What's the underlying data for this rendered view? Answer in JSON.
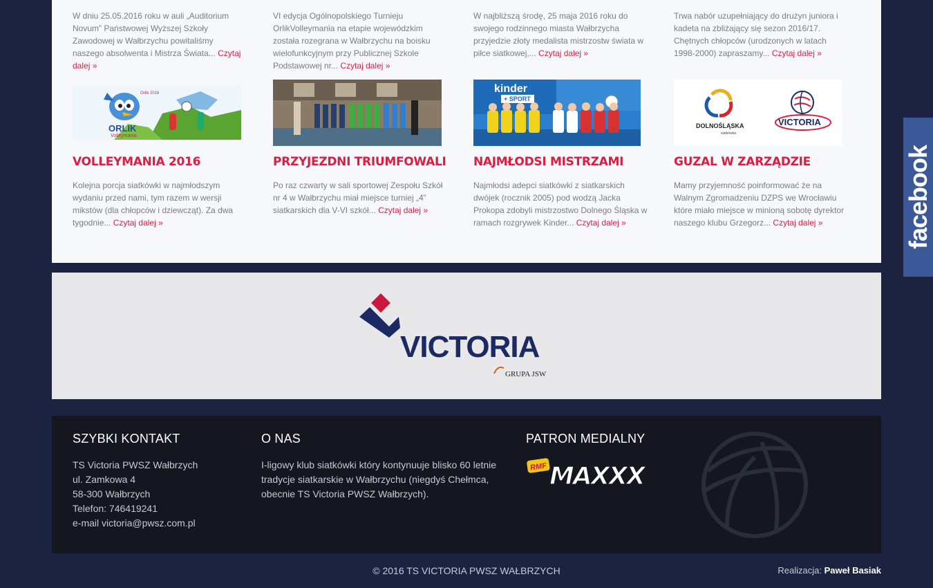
{
  "articles_top": [
    {
      "excerpt": "W dniu 25.05.2016 roku w auli „Auditorium Novum” Państwowej Wyższej Szkoły Zawodowej w Wałbrzychu powitaliśmy naszego absolwenta i Mistrza Świata...",
      "more": "Czytaj dalej »"
    },
    {
      "excerpt": "VI edycja Ogólnopolskiego Turnieju OrlikVolleymania na etapie wojewódzkim została rozegrana w Wałbrzychu na boisku wielofunkcyjnym przy Publicznej Szkole Podstawowej nr...",
      "more": "Czytaj dalej »"
    },
    {
      "excerpt": "W najbliższą środę, 25 maja 2016 roku do swojego rodzinnego miasta Wałbrzycha przyjedzie złoty medalista mistrzostw świata w piłce siatkowej,...",
      "more": "Czytaj dalej »"
    },
    {
      "excerpt": "Trwa nabór uzupełniający do drużyn juniora i kadeta na zbliżający się sezon 2016/17. Chętnych chłopców (urodzonych w latach 1998-2000) zapraszamy...",
      "more": "Czytaj dalej »"
    }
  ],
  "articles": [
    {
      "title": "VOLLEYMANIA 2016",
      "excerpt": "Kolejna porcja siatkówki w najmłodszym wydaniu przed nami, tym razem w wersji mikstów (dla chłopców i dziewcząt). Za dwa tygodnie...",
      "more": "Czytaj dalej »",
      "image_text": {
        "brand": "ORLIK",
        "sub": "Volleymania",
        "corner": "Orlik 2016"
      }
    },
    {
      "title": "PRZYJEZDNI TRIUMFOWALI",
      "excerpt": "Po raz czwarty w sali sportowej Zespołu Szkół nr 4 w Wałbrzychu miał miejsce turniej „4” siatkarskich dla V-VI szkół...",
      "more": "Czytaj dalej »"
    },
    {
      "title": "NAJMŁODSI MISTRZAMI",
      "excerpt": "Najmłodsi adepci siatkówki z siatkarskich dwójek (rocznik 2005) pod wodzą Jacka Prokopa zdobyli mistrzostwo Dolnego Śląska w ramach rozgrywek Kinder...",
      "more": "Czytaj dalej »",
      "image_text": {
        "banner": "kinder",
        "banner_sub": "+ SPORT"
      }
    },
    {
      "title": "GUZAL W ZARZĄDZIE",
      "excerpt": "Mamy przyjemność poinformować że na Walnym Zgromadzeniu DZPS we Wrocławiu które miało miejsce w minioną sobotę dyrektor naszego klubu Grzegorz...",
      "more": "Czytaj dalej »",
      "image_text": {
        "left_logo": "DOLNOŚLĄSKA",
        "left_logo_sub": "siatkówka",
        "right_logo": "VICTORIA"
      }
    }
  ],
  "sponsor": {
    "name": "VICTORIA",
    "group": "GRUPA JSW"
  },
  "footer": {
    "contact": {
      "heading": "SZYBKI KONTAKT",
      "lines": [
        "TS Victoria PWSZ Wałbrzych",
        "ul. Zamkowa 4",
        "58-300 Wałbrzych",
        "Telefon: 746419241",
        "e-mail victoria@pwsz.com.pl"
      ]
    },
    "about": {
      "heading": "O NAS",
      "lines": [
        "I-ligowy klub siatkówki który kontynuuje blisko 60 letnie",
        "tradycje siatkarskie w Wałbrzychu (niegdyś Chełmca,",
        "obecnie TS Victoria PWSZ Wałbrzych)."
      ]
    },
    "patron": {
      "heading": "PATRON MEDIALNY",
      "badge": "RMF",
      "name": "MAXXX"
    }
  },
  "copyright": "© 2016 TS VICTORIA PWSZ WAŁBRZYCH",
  "credit": {
    "label": "Realizacja:",
    "name": "Paweł Basiak"
  },
  "facebook": {
    "label": "facebook"
  },
  "colors": {
    "accent": "#d81f43",
    "page_bg": "#1c2340",
    "footer_bg": "#14171f",
    "facebook": "#3b5998",
    "brand_navy": "#1b2a63"
  }
}
